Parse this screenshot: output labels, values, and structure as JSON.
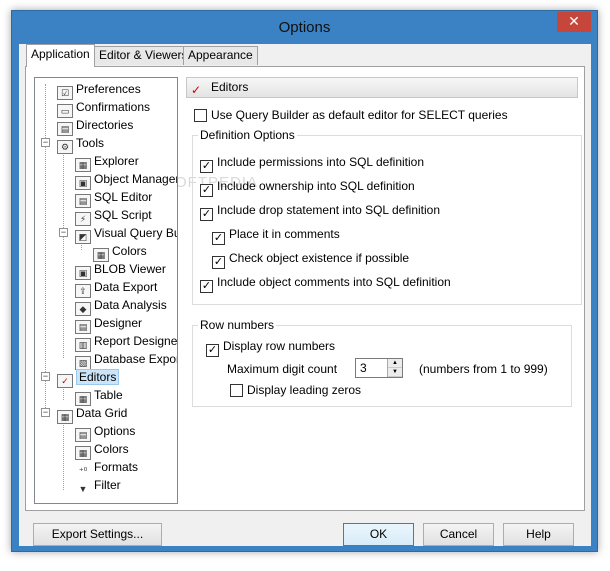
{
  "window": {
    "title": "Options",
    "close_glyph": "✕"
  },
  "tabs": [
    {
      "label": "Application",
      "active": true
    },
    {
      "label": "Editor & Viewers",
      "active": false
    },
    {
      "label": "Appearance",
      "active": false
    }
  ],
  "tree": {
    "preferences": "Preferences",
    "confirmations": "Confirmations",
    "directories": "Directories",
    "tools": "Tools",
    "explorer": "Explorer",
    "object_manager": "Object Manager",
    "sql_editor": "SQL Editor",
    "sql_script": "SQL Script",
    "visual_query_builder": "Visual Query Builder",
    "colors": "Colors",
    "blob_viewer": "BLOB Viewer",
    "data_export": "Data Export",
    "data_analysis": "Data Analysis",
    "designer": "Designer",
    "report_designer": "Report Designer",
    "database_export": "Database Export",
    "editors": "Editors",
    "table": "Table",
    "data_grid": "Data Grid",
    "options": "Options",
    "grid_colors": "Colors",
    "formats": "Formats",
    "filter": "Filter",
    "expand_minus": "−"
  },
  "editors_section": {
    "header": "Editors",
    "use_query_builder": {
      "label": "Use Query Builder as default editor for SELECT queries",
      "checked": false
    },
    "definition_options": {
      "label": "Definition Options",
      "include_permissions": {
        "label": "Include permissions into SQL definition",
        "checked": true
      },
      "include_ownership": {
        "label": "Include ownership into SQL definition",
        "checked": true
      },
      "include_drop": {
        "label": "Include drop statement into SQL definition",
        "checked": true
      },
      "place_in_comments": {
        "label": "Place it in comments",
        "checked": true
      },
      "check_existence": {
        "label": "Check object existence if possible",
        "checked": true
      },
      "include_comments": {
        "label": "Include object comments into SQL definition",
        "checked": true
      }
    },
    "row_numbers": {
      "label": "Row numbers",
      "display_row_numbers": {
        "label": "Display row numbers",
        "checked": true
      },
      "max_digit_label": "Maximum digit count",
      "max_digit_value": "3",
      "range_hint": "(numbers from 1 to 999)",
      "leading_zeros": {
        "label": "Display leading zeros",
        "checked": false
      }
    }
  },
  "buttons": {
    "export_settings": "Export Settings...",
    "ok": "OK",
    "cancel": "Cancel",
    "help": "Help"
  },
  "check_glyph": "✓",
  "watermark": "SOFTPEDIA"
}
